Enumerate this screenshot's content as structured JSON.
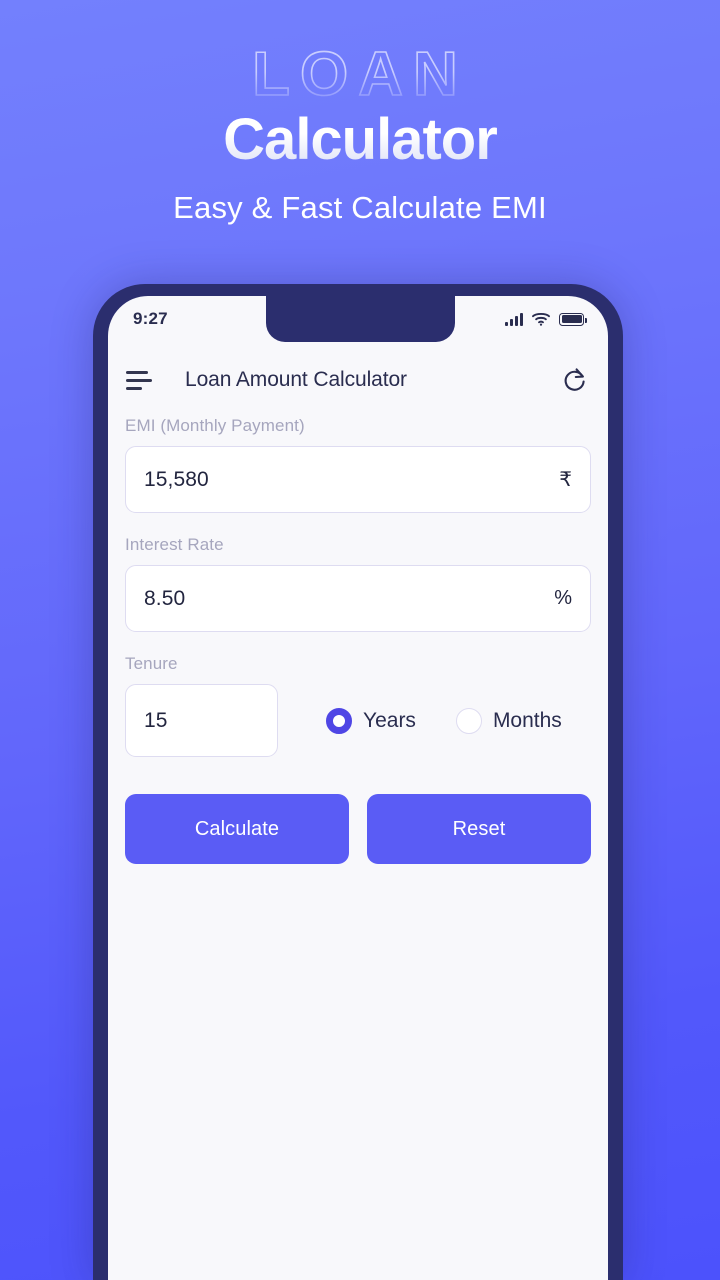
{
  "promo": {
    "outline_text": "LOAN",
    "title": "Calculator",
    "subtitle": "Easy & Fast Calculate EMI"
  },
  "phone": {
    "status_bar": {
      "time": "9:27",
      "signal_icon": "signal-bars-icon",
      "wifi_icon": "wifi-icon",
      "battery_icon": "battery-full-icon"
    },
    "app_bar": {
      "menu_icon": "hamburger-menu-icon",
      "title": "Loan Amount Calculator",
      "refresh_icon": "refresh-icon"
    },
    "form": {
      "emi": {
        "label": "EMI (Monthly Payment)",
        "value": "15,580",
        "placeholder": "EMI (Monthly Payment)",
        "suffix": "₹"
      },
      "interest": {
        "label": "Interest Rate",
        "value": "8.50",
        "placeholder": "Interest Rate",
        "suffix": "%"
      },
      "tenure": {
        "label": "Tenure",
        "value": "15",
        "placeholder": "Tenure",
        "options": [
          {
            "label": "Years",
            "selected": true
          },
          {
            "label": "Months",
            "selected": false
          }
        ]
      },
      "buttons": {
        "calculate": "Calculate",
        "reset": "Reset"
      }
    }
  },
  "colors": {
    "background_top": "#7380FD",
    "background_bottom": "#4C52FC",
    "phone_bezel": "#2B2E6E",
    "screen_bg": "#F8F8FB",
    "accent": "#5A5CF5",
    "radio_selected": "#4F46E5",
    "input_border": "#DEDCF1",
    "label_text": "#A6A6BE",
    "primary_text": "#2A2D4F"
  }
}
